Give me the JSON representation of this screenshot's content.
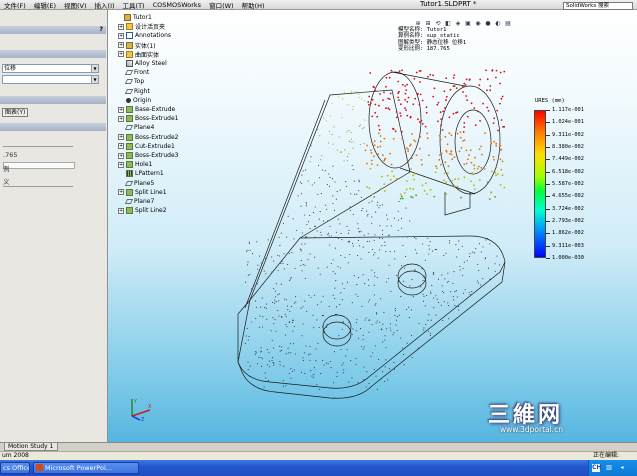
{
  "menubar": {
    "items": [
      "文件(F)",
      "编辑(E)",
      "视图(V)",
      "插入(I)",
      "工具(T)",
      "COSMOSWorks",
      "窗口(W)",
      "帮助(H)"
    ],
    "document_title": "Tutor1.SLDPRT *",
    "search_placeholder": "SolidWorks 搜索"
  },
  "property_manager": {
    "help_label": "?",
    "select_value": "位移",
    "button_label": "图表(Y)",
    "value_text": ".765",
    "label_1": "例",
    "label_2": "义"
  },
  "feature_tree": {
    "items": [
      {
        "label": "Tutor1",
        "icon": "part-icon",
        "indent": 0,
        "expandable": false
      },
      {
        "label": "设计活页夹",
        "icon": "folder-icon",
        "indent": 1,
        "expandable": true
      },
      {
        "label": "Annotations",
        "icon": "annotations-icon",
        "indent": 1,
        "expandable": true
      },
      {
        "label": "实体(1)",
        "icon": "solid-bodies-icon",
        "indent": 1,
        "expandable": true
      },
      {
        "label": "曲面实体",
        "icon": "surface-bodies-icon",
        "indent": 1,
        "expandable": true
      },
      {
        "label": "Alloy Steel",
        "icon": "material-icon",
        "indent": 1,
        "expandable": false
      },
      {
        "label": "Front",
        "icon": "plane-icon",
        "indent": 1,
        "expandable": false
      },
      {
        "label": "Top",
        "icon": "plane-icon",
        "indent": 1,
        "expandable": false
      },
      {
        "label": "Right",
        "icon": "plane-icon",
        "indent": 1,
        "expandable": false
      },
      {
        "label": "Origin",
        "icon": "origin-icon",
        "indent": 1,
        "expandable": false
      },
      {
        "label": "Base-Extrude",
        "icon": "extrude-icon",
        "indent": 1,
        "expandable": true
      },
      {
        "label": "Boss-Extrude1",
        "icon": "extrude-icon",
        "indent": 1,
        "expandable": true
      },
      {
        "label": "Plane4",
        "icon": "plane-icon",
        "indent": 1,
        "expandable": false
      },
      {
        "label": "Boss-Extrude2",
        "icon": "extrude-icon",
        "indent": 1,
        "expandable": true
      },
      {
        "label": "Cut-Extrude1",
        "icon": "cut-icon",
        "indent": 1,
        "expandable": true
      },
      {
        "label": "Boss-Extrude3",
        "icon": "extrude-icon",
        "indent": 1,
        "expandable": true
      },
      {
        "label": "Hole1",
        "icon": "hole-icon",
        "indent": 1,
        "expandable": true
      },
      {
        "label": "LPattern1",
        "icon": "pattern-icon",
        "indent": 1,
        "expandable": false
      },
      {
        "label": "Plane5",
        "icon": "plane-icon",
        "indent": 1,
        "expandable": false
      },
      {
        "label": "Split Line1",
        "icon": "split-line-icon",
        "indent": 1,
        "expandable": true
      },
      {
        "label": "Plane7",
        "icon": "plane-icon",
        "indent": 1,
        "expandable": false
      },
      {
        "label": "Split Line2",
        "icon": "split-line-icon",
        "indent": 1,
        "expandable": true
      }
    ]
  },
  "study_info": {
    "lines": [
      "模型名称: Tutor1",
      "算例名称: sup_static",
      "图解类型: 静态位移 位移1",
      "变形比例: 187.765"
    ]
  },
  "legend": {
    "title": "URES (mm)",
    "labels": [
      "1.117e-001",
      "1.024e-001",
      "9.311e-002",
      "8.380e-002",
      "7.449e-002",
      "6.518e-002",
      "5.587e-002",
      "4.655e-002",
      "3.724e-002",
      "2.793e-002",
      "1.862e-002",
      "9.311e-003",
      "1.000e-030"
    ],
    "max_color": "#ff0000",
    "min_color": "#0000ff"
  },
  "triad": {
    "x_label": "X",
    "y_label": "Y",
    "z_label": "Z"
  },
  "watermark": {
    "title": "三維网",
    "url": "www.3dportal.cn"
  },
  "tabs": {
    "active": "",
    "motion_study": "Motion Study 1"
  },
  "statusbar": {
    "left_text": "um 2008",
    "right_text": "正在编辑:"
  },
  "taskbar": {
    "items": [
      "cs Office ...",
      "Microsoft PowerPoi..."
    ],
    "tray_icons": [
      "CH",
      "network-icon",
      "volume-icon"
    ]
  }
}
